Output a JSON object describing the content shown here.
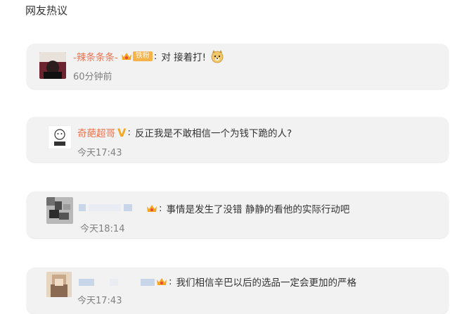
{
  "section": {
    "title": "网友热议"
  },
  "comments": [
    {
      "username": "-辣条条条-",
      "badge_tag": "铁粉",
      "text": "对 接着打!",
      "emoji": "doge-emoji",
      "time": "60分钟前"
    },
    {
      "username": "奇葩超哥",
      "badge_tag": "",
      "text": "反正我是不敢相信一个为钱下跪的人?",
      "emoji": "",
      "time": "今天17:43"
    },
    {
      "username": "",
      "badge_tag": "",
      "text": "事情是发生了没错 静静的看他的实际行动吧",
      "emoji": "",
      "time": "今天18:14"
    },
    {
      "username": "",
      "badge_tag": "",
      "text": "我们相信辛巴以后的选品一定会更加的严格",
      "emoji": "",
      "time": "今天17:43"
    }
  ],
  "colors": {
    "card_bg": "#f2f2f2",
    "username": "#eb7350",
    "time": "#808080",
    "badge_orange": "#f7b24a"
  }
}
